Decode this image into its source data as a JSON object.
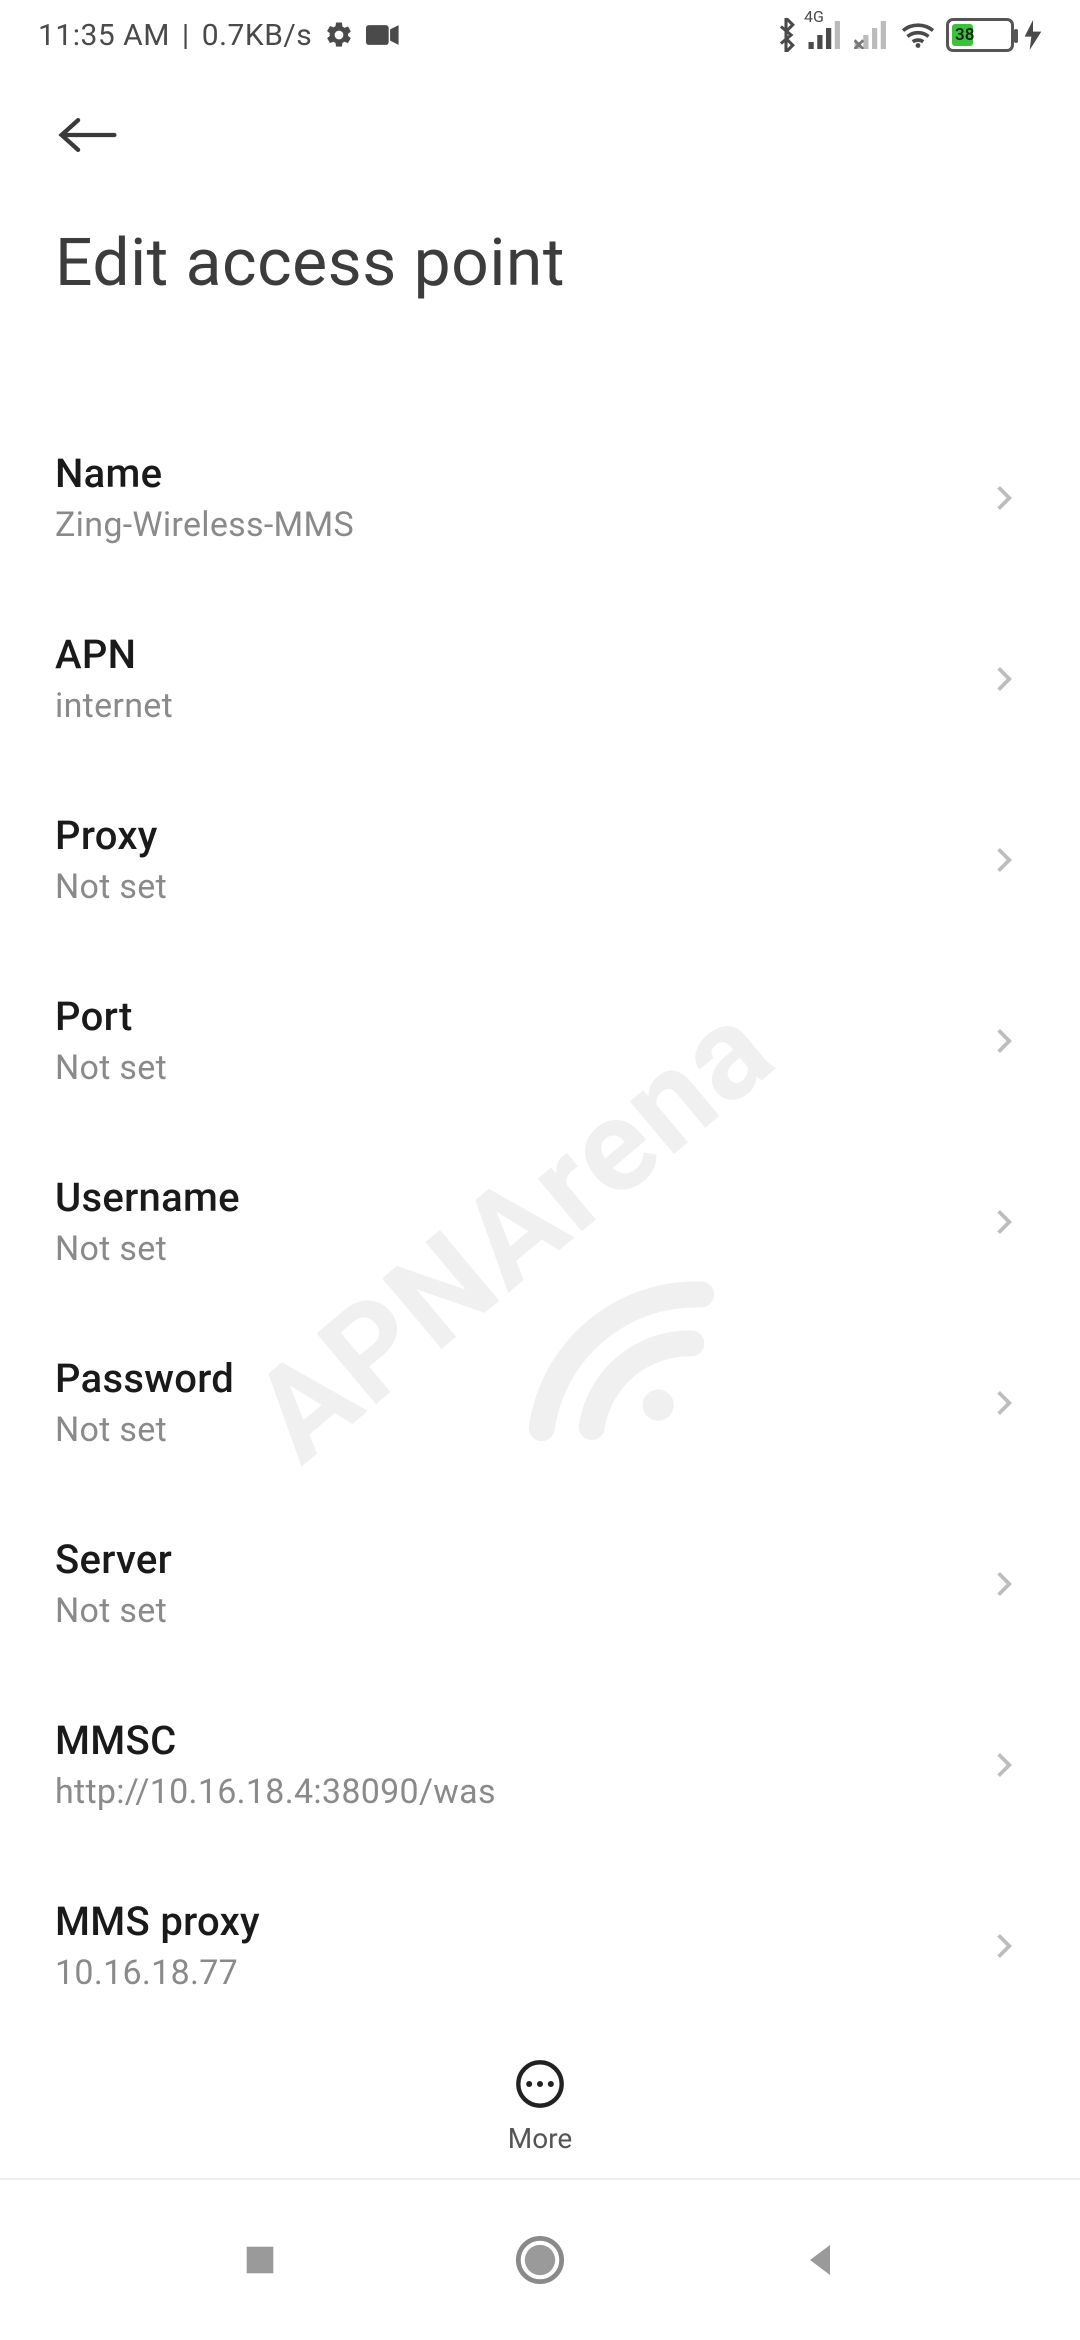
{
  "status": {
    "time": "11:35 AM",
    "sep": "|",
    "speed": "0.7KB/s",
    "net_label": "4G",
    "battery_pct": "38"
  },
  "header": {
    "title": "Edit access point"
  },
  "settings": [
    {
      "label": "Name",
      "value": "Zing-Wireless-MMS"
    },
    {
      "label": "APN",
      "value": "internet"
    },
    {
      "label": "Proxy",
      "value": "Not set"
    },
    {
      "label": "Port",
      "value": "Not set"
    },
    {
      "label": "Username",
      "value": "Not set"
    },
    {
      "label": "Password",
      "value": "Not set"
    },
    {
      "label": "Server",
      "value": "Not set"
    },
    {
      "label": "MMSC",
      "value": "http://10.16.18.4:38090/was"
    },
    {
      "label": "MMS proxy",
      "value": "10.16.18.77"
    }
  ],
  "toolbar": {
    "more_label": "More"
  },
  "watermark": {
    "text": "APNArena"
  }
}
